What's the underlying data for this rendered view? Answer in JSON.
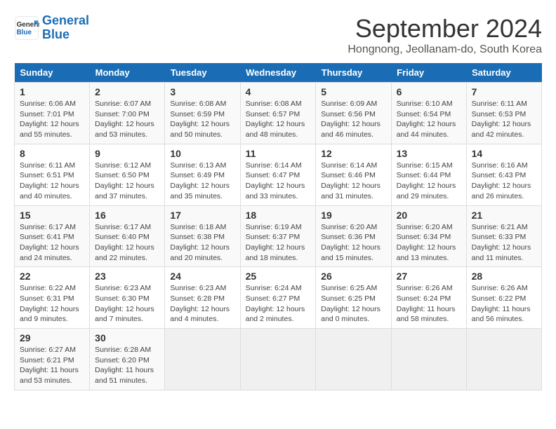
{
  "header": {
    "logo_line1": "General",
    "logo_line2": "Blue",
    "month_title": "September 2024",
    "location": "Hongnong, Jeollanam-do, South Korea"
  },
  "weekdays": [
    "Sunday",
    "Monday",
    "Tuesday",
    "Wednesday",
    "Thursday",
    "Friday",
    "Saturday"
  ],
  "weeks": [
    [
      {
        "day": "1",
        "sunrise": "6:06 AM",
        "sunset": "7:01 PM",
        "daylight": "12 hours and 55 minutes."
      },
      {
        "day": "2",
        "sunrise": "6:07 AM",
        "sunset": "7:00 PM",
        "daylight": "12 hours and 53 minutes."
      },
      {
        "day": "3",
        "sunrise": "6:08 AM",
        "sunset": "6:59 PM",
        "daylight": "12 hours and 50 minutes."
      },
      {
        "day": "4",
        "sunrise": "6:08 AM",
        "sunset": "6:57 PM",
        "daylight": "12 hours and 48 minutes."
      },
      {
        "day": "5",
        "sunrise": "6:09 AM",
        "sunset": "6:56 PM",
        "daylight": "12 hours and 46 minutes."
      },
      {
        "day": "6",
        "sunrise": "6:10 AM",
        "sunset": "6:54 PM",
        "daylight": "12 hours and 44 minutes."
      },
      {
        "day": "7",
        "sunrise": "6:11 AM",
        "sunset": "6:53 PM",
        "daylight": "12 hours and 42 minutes."
      }
    ],
    [
      {
        "day": "8",
        "sunrise": "6:11 AM",
        "sunset": "6:51 PM",
        "daylight": "12 hours and 40 minutes."
      },
      {
        "day": "9",
        "sunrise": "6:12 AM",
        "sunset": "6:50 PM",
        "daylight": "12 hours and 37 minutes."
      },
      {
        "day": "10",
        "sunrise": "6:13 AM",
        "sunset": "6:49 PM",
        "daylight": "12 hours and 35 minutes."
      },
      {
        "day": "11",
        "sunrise": "6:14 AM",
        "sunset": "6:47 PM",
        "daylight": "12 hours and 33 minutes."
      },
      {
        "day": "12",
        "sunrise": "6:14 AM",
        "sunset": "6:46 PM",
        "daylight": "12 hours and 31 minutes."
      },
      {
        "day": "13",
        "sunrise": "6:15 AM",
        "sunset": "6:44 PM",
        "daylight": "12 hours and 29 minutes."
      },
      {
        "day": "14",
        "sunrise": "6:16 AM",
        "sunset": "6:43 PM",
        "daylight": "12 hours and 26 minutes."
      }
    ],
    [
      {
        "day": "15",
        "sunrise": "6:17 AM",
        "sunset": "6:41 PM",
        "daylight": "12 hours and 24 minutes."
      },
      {
        "day": "16",
        "sunrise": "6:17 AM",
        "sunset": "6:40 PM",
        "daylight": "12 hours and 22 minutes."
      },
      {
        "day": "17",
        "sunrise": "6:18 AM",
        "sunset": "6:38 PM",
        "daylight": "12 hours and 20 minutes."
      },
      {
        "day": "18",
        "sunrise": "6:19 AM",
        "sunset": "6:37 PM",
        "daylight": "12 hours and 18 minutes."
      },
      {
        "day": "19",
        "sunrise": "6:20 AM",
        "sunset": "6:36 PM",
        "daylight": "12 hours and 15 minutes."
      },
      {
        "day": "20",
        "sunrise": "6:20 AM",
        "sunset": "6:34 PM",
        "daylight": "12 hours and 13 minutes."
      },
      {
        "day": "21",
        "sunrise": "6:21 AM",
        "sunset": "6:33 PM",
        "daylight": "12 hours and 11 minutes."
      }
    ],
    [
      {
        "day": "22",
        "sunrise": "6:22 AM",
        "sunset": "6:31 PM",
        "daylight": "12 hours and 9 minutes."
      },
      {
        "day": "23",
        "sunrise": "6:23 AM",
        "sunset": "6:30 PM",
        "daylight": "12 hours and 7 minutes."
      },
      {
        "day": "24",
        "sunrise": "6:23 AM",
        "sunset": "6:28 PM",
        "daylight": "12 hours and 4 minutes."
      },
      {
        "day": "25",
        "sunrise": "6:24 AM",
        "sunset": "6:27 PM",
        "daylight": "12 hours and 2 minutes."
      },
      {
        "day": "26",
        "sunrise": "6:25 AM",
        "sunset": "6:25 PM",
        "daylight": "12 hours and 0 minutes."
      },
      {
        "day": "27",
        "sunrise": "6:26 AM",
        "sunset": "6:24 PM",
        "daylight": "11 hours and 58 minutes."
      },
      {
        "day": "28",
        "sunrise": "6:26 AM",
        "sunset": "6:22 PM",
        "daylight": "11 hours and 56 minutes."
      }
    ],
    [
      {
        "day": "29",
        "sunrise": "6:27 AM",
        "sunset": "6:21 PM",
        "daylight": "11 hours and 53 minutes."
      },
      {
        "day": "30",
        "sunrise": "6:28 AM",
        "sunset": "6:20 PM",
        "daylight": "11 hours and 51 minutes."
      },
      {
        "day": "",
        "sunrise": "",
        "sunset": "",
        "daylight": ""
      },
      {
        "day": "",
        "sunrise": "",
        "sunset": "",
        "daylight": ""
      },
      {
        "day": "",
        "sunrise": "",
        "sunset": "",
        "daylight": ""
      },
      {
        "day": "",
        "sunrise": "",
        "sunset": "",
        "daylight": ""
      },
      {
        "day": "",
        "sunrise": "",
        "sunset": "",
        "daylight": ""
      }
    ]
  ]
}
